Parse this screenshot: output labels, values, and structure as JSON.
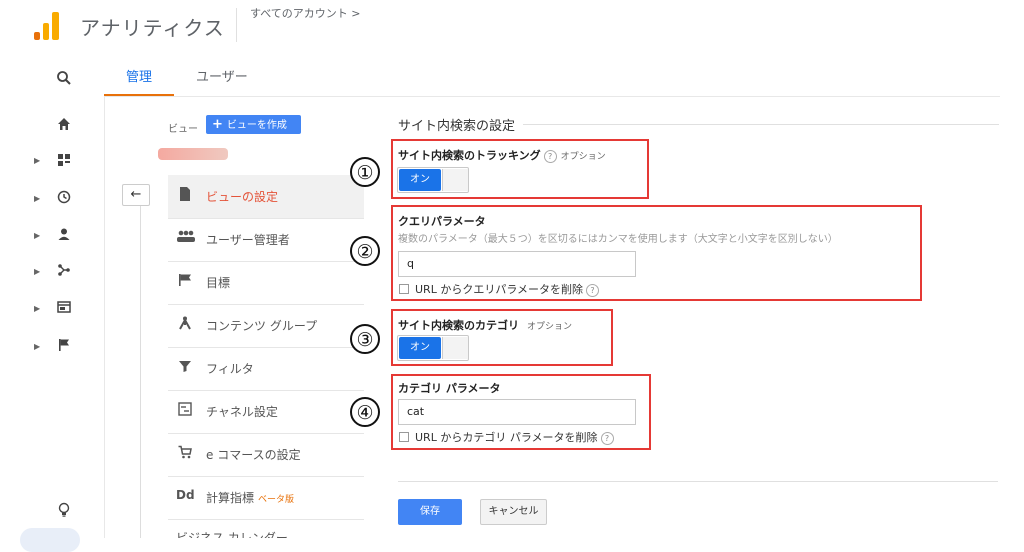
{
  "header": {
    "app_title": "アナリティクス",
    "account_breadcrumb": "すべてのアカウント >"
  },
  "rail": {
    "icons": [
      "search-icon",
      "home-icon",
      "dashboard-icon",
      "clock-icon",
      "person-icon",
      "acquisition-icon",
      "behavior-icon",
      "flag-icon",
      "lightbulb-icon"
    ]
  },
  "tabs": [
    {
      "label": "管理",
      "active": true
    },
    {
      "label": "ユーザー",
      "active": false
    }
  ],
  "view_column": {
    "label": "ビュー",
    "create_button": "ビューを作成",
    "back_glyph": "←",
    "items": [
      {
        "label": "ビューの設定",
        "icon": "document-icon",
        "active": true
      },
      {
        "label": "ユーザー管理者",
        "icon": "users-icon",
        "active": false
      },
      {
        "label": "目標",
        "icon": "flag-icon",
        "active": false
      },
      {
        "label": "コンテンツ グループ",
        "icon": "content-group-icon",
        "active": false
      },
      {
        "label": "フィルタ",
        "icon": "filter-icon",
        "active": false
      },
      {
        "label": "チャネル設定",
        "icon": "channel-icon",
        "active": false
      },
      {
        "label": "e コマースの設定",
        "icon": "cart-icon",
        "active": false
      },
      {
        "label": "計算指標",
        "icon": "dd-icon",
        "badge": "ベータ版",
        "active": false
      }
    ],
    "cut_off_label": "ビジネス カレンダー"
  },
  "main": {
    "section_title": "サイト内検索の設定",
    "tracking": {
      "number": "①",
      "label": "サイト内検索のトラッキング",
      "help": "?",
      "option": "オプション",
      "toggle": "オン"
    },
    "query_param": {
      "number": "②",
      "label": "クエリパラメータ",
      "hint": "複数のパラメータ（最大５つ）を区切るにはカンマを使用します（大文字と小文字を区別しない）",
      "value": "q",
      "checkbox_label": "URL からクエリパラメータを削除",
      "help": "?"
    },
    "category": {
      "number": "③",
      "label": "サイト内検索のカテゴリ",
      "option": "オプション",
      "toggle": "オン"
    },
    "category_param": {
      "number": "④",
      "label": "カテゴリ パラメータ",
      "value": "cat",
      "checkbox_label": "URL からカテゴリ パラメータを削除",
      "help": "?"
    },
    "save_button": "保存",
    "cancel_button": "キャンセル"
  },
  "colors": {
    "accent_blue": "#4285f4",
    "toggle_blue": "#1a73e8",
    "annotation_red": "#e53935",
    "active_nav_text": "#e4543a",
    "tab_underline": "#e8710a"
  }
}
